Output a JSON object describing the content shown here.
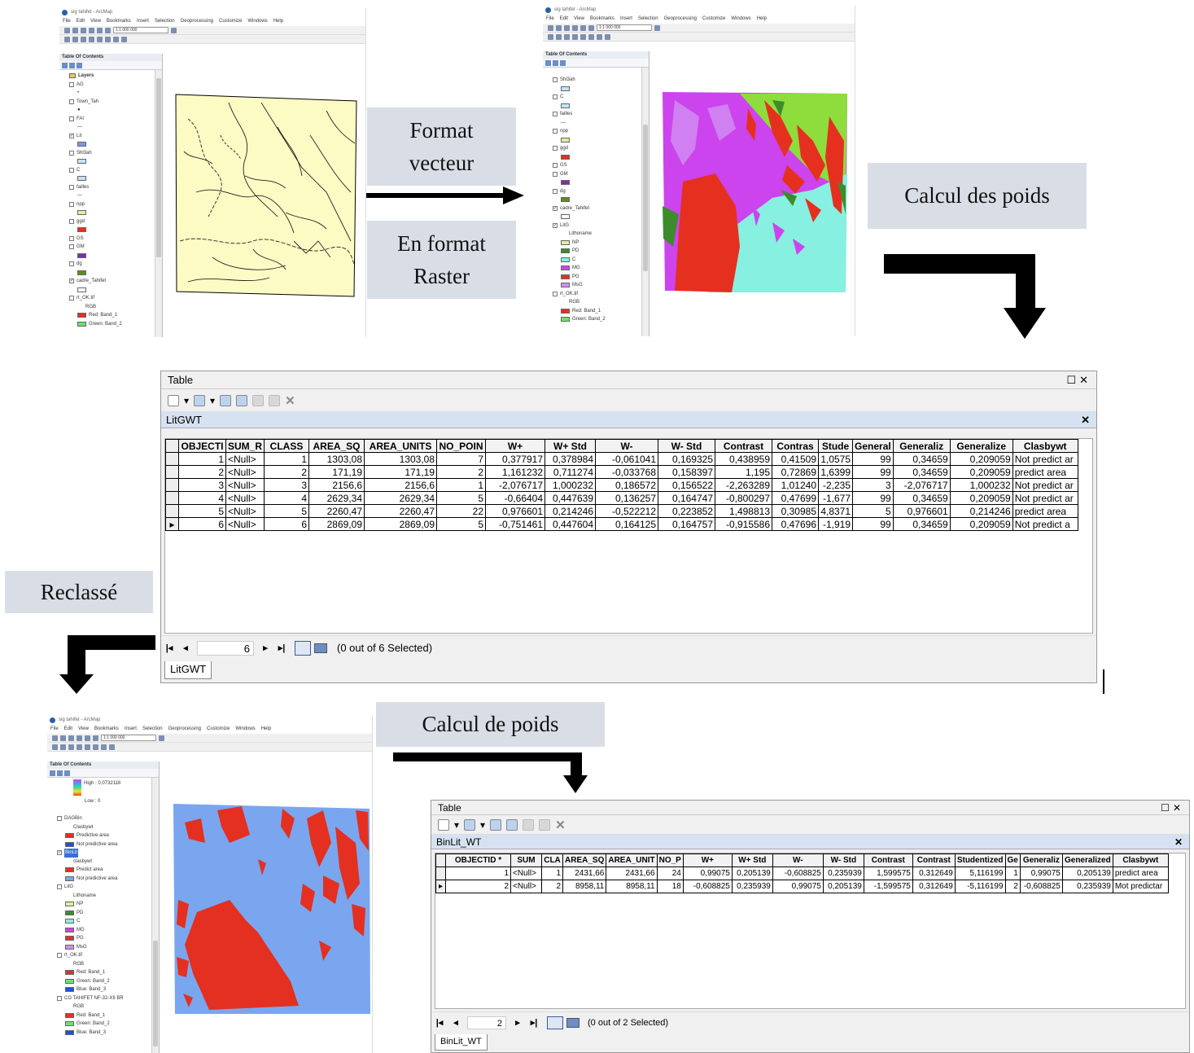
{
  "labels": {
    "vector_line1": "Format",
    "vector_line2": "vecteur",
    "raster_line1": "En format",
    "raster_line2": "Raster",
    "weights": "Calcul des poids",
    "reclass": "Reclassé",
    "weights2": "Calcul de poids"
  },
  "arcmap1": {
    "title": "sig tahifet - ArcMap",
    "menu": [
      "File",
      "Edit",
      "View",
      "Bookmarks",
      "Insert",
      "Selection",
      "Geoprocessing",
      "Customize",
      "Windows",
      "Help"
    ],
    "toc_title": "Table Of Contents",
    "layers": [
      "Layers",
      "AG",
      "Town_Tah",
      "FAI",
      "Lit",
      "Shl3ah",
      "C",
      "failles",
      "npp",
      "ggd",
      "GS",
      "GM",
      "dg",
      "cadre_Tahifet",
      "rt_OK.tif",
      "RGB",
      "Red: Band_1",
      "Green: Band_2"
    ],
    "scale": "1:1 000 000"
  },
  "arcmap2": {
    "title": "sig tahifet - ArcMap",
    "menu": [
      "File",
      "Edit",
      "View",
      "Bookmarks",
      "Insert",
      "Selection",
      "Geoprocessing",
      "Customize",
      "Windows",
      "Help"
    ],
    "toc_title": "Table Of Contents",
    "layers": [
      "Shl3ah",
      "C",
      "failles",
      "npp",
      "ggd",
      "GS",
      "GM",
      "dg",
      "cadre_Tahifet",
      "LitG",
      "Lithoname",
      "NP",
      "PD",
      "C",
      "MG",
      "PG",
      "MsG",
      "rt_OK.tif",
      "RGB",
      "Red: Band_1",
      "Green: Band_2"
    ],
    "scale": "1:1 000 000"
  },
  "arcmap3": {
    "title": "sig tahifet - ArcMap",
    "menu": [
      "File",
      "Edit",
      "View",
      "Bookmarks",
      "Insert",
      "Selection",
      "Geoprocessing",
      "Customize",
      "Windows",
      "Help"
    ],
    "toc_title": "Table Of Contents",
    "layers": [
      "High : 0,0732118",
      "Low : 0",
      "DAGBin",
      "Clasbywt",
      "Predictive area",
      "Not predictive area",
      "BinLit",
      "clasbywt",
      "Predict area",
      "Not predictive area",
      "LitG",
      "Lithoname",
      "NP",
      "PD",
      "C",
      "MG",
      "PG",
      "MsG",
      "rt_OK.tif",
      "RGB",
      "Red: Band_1",
      "Green: Band_2",
      "Blue: Band_3",
      "CG TAHIFET NF-32-XII BR",
      "RGB",
      "Red: Band_1",
      "Green: Band_2",
      "Blue: Band_3"
    ],
    "scale": "1:1 000 000"
  },
  "colors": {
    "label_bg": "#d9dee6",
    "vector_fill": "#fdfbc4",
    "litho_magenta": "#cc44ee",
    "litho_green": "#8edd3c",
    "litho_red": "#e53020",
    "litho_cyan": "#88f0e0",
    "bin_blue": "#7aa6f0",
    "bin_red": "#e33020",
    "subtitle_bg": "#d6e2f2"
  },
  "table1": {
    "window_title": "Table",
    "name": "LitGWT",
    "columns": [
      "OBJECTI",
      "SUM_R",
      "CLASS",
      "AREA_SQ",
      "AREA_UNITS",
      "NO_POIN",
      "W+",
      "W+ Std",
      "W-",
      "W- Std",
      "Contrast",
      "Contras",
      "Stude",
      "General",
      "Generaliz",
      "Generalize",
      "Clasbywt"
    ],
    "rows": [
      [
        "1",
        "<Null>",
        "1",
        "1303,08",
        "1303,08",
        "7",
        "0,377917",
        "0,378984",
        "-0,061041",
        "0,169325",
        "0,438959",
        "0,41509",
        "1,0575",
        "99",
        "0,34659",
        "0,209059",
        "Not predict ar"
      ],
      [
        "2",
        "<Null>",
        "2",
        "171,19",
        "171,19",
        "2",
        "1,161232",
        "0,711274",
        "-0,033768",
        "0,158397",
        "1,195",
        "0,72869",
        "1,6399",
        "99",
        "0,34659",
        "0,209059",
        "predict area"
      ],
      [
        "3",
        "<Null>",
        "3",
        "2156,6",
        "2156,6",
        "1",
        "-2,076717",
        "1,000232",
        "0,186572",
        "0,156522",
        "-2,263289",
        "1,01240",
        "-2,235",
        "3",
        "-2,076717",
        "1,000232",
        "Not predict ar"
      ],
      [
        "4",
        "<Null>",
        "4",
        "2629,34",
        "2629,34",
        "5",
        "-0,66404",
        "0,447639",
        "0,136257",
        "0,164747",
        "-0,800297",
        "0,47699",
        "-1,677",
        "99",
        "0,34659",
        "0,209059",
        "Not predict ar"
      ],
      [
        "5",
        "<Null>",
        "5",
        "2260,47",
        "2260,47",
        "22",
        "0,976601",
        "0,214246",
        "-0,522212",
        "0,223852",
        "1,498813",
        "0,30985",
        "4,8371",
        "5",
        "0,976601",
        "0,214246",
        "predict area"
      ],
      [
        "6",
        "<Null>",
        "6",
        "2869,09",
        "2869,09",
        "5",
        "-0,751461",
        "0,447604",
        "0,164125",
        "0,164757",
        "-0,915586",
        "0,47696",
        "-1,919",
        "99",
        "0,34659",
        "0,209059",
        "Not predict a"
      ]
    ],
    "record": "6",
    "selection": "(0 out of 6 Selected)",
    "tab": "LitGWT"
  },
  "table2": {
    "window_title": "Table",
    "name": "BinLit_WT",
    "columns": [
      "OBJECTID *",
      "SUM",
      "CLA",
      "AREA_SQ",
      "AREA_UNIT",
      "NO_P",
      "W+",
      "W+ Std",
      "W-",
      "W- Std",
      "Contrast",
      "Contrast",
      "Studentized",
      "Ge",
      "Generaliz",
      "Generalized",
      "Clasbywt"
    ],
    "rows": [
      [
        "1",
        "<Null>",
        "1",
        "2431,66",
        "2431,66",
        "24",
        "0,99075",
        "0,205139",
        "-0,608825",
        "0,235939",
        "1,599575",
        "0,312649",
        "5,116199",
        "1",
        "0,99075",
        "0,205139",
        "predict area"
      ],
      [
        "2",
        "<Null>",
        "2",
        "8958,11",
        "8958,11",
        "18",
        "-0,608825",
        "0,235939",
        "0,99075",
        "0,205139",
        "-1,599575",
        "0,312649",
        "-5,116199",
        "2",
        "-0,608825",
        "0,235939",
        "Mot predictar"
      ]
    ],
    "record": "2",
    "selection": "(0 out of 2 Selected)",
    "tab": "BinLit_WT"
  }
}
